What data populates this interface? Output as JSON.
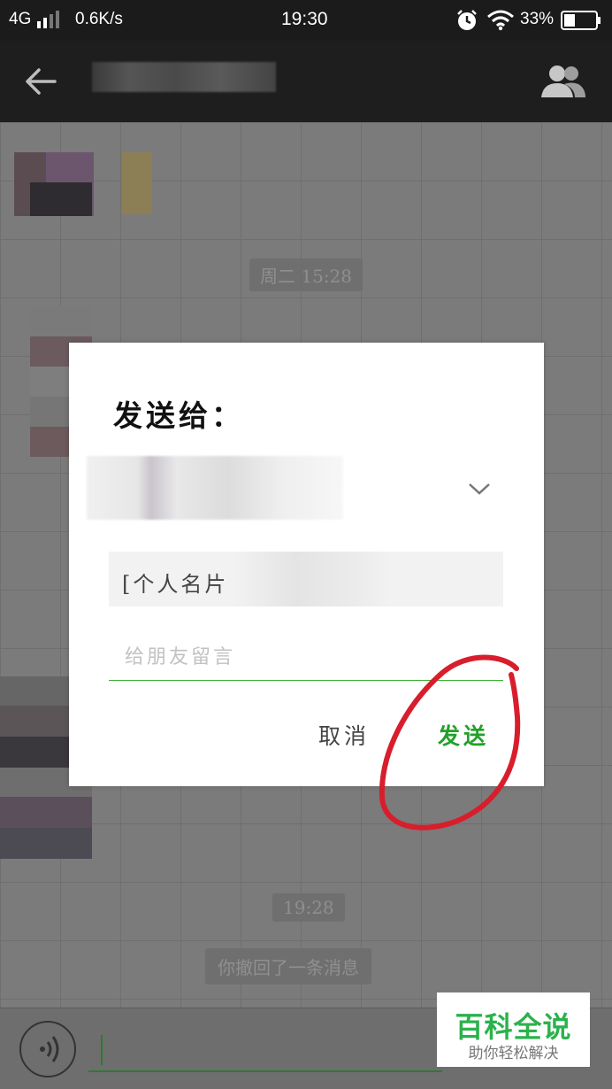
{
  "status_bar": {
    "network": "4G",
    "speed": "0.6K/s",
    "time": "19:30",
    "battery_percent": "33%",
    "icons": [
      "signal-icon",
      "alarm-icon",
      "wifi-icon",
      "battery-icon"
    ]
  },
  "title_bar": {
    "back_icon": "arrow-left-icon",
    "group_icon": "group-members-icon"
  },
  "chat": {
    "timestamps": [
      "周二 15:28",
      "19:28"
    ],
    "system_message": "你撤回了一条消息"
  },
  "dialog": {
    "title": "发送给：",
    "card_label": "[个人名片",
    "message_placeholder": "给朋友留言",
    "cancel_label": "取消",
    "send_label": "发送"
  },
  "watermark": {
    "title": "百科全说",
    "subtitle": "助你轻松解决"
  },
  "colors": {
    "accent_green": "#22a02a",
    "annotation_red": "#d81e2c",
    "status_bar_bg": "#1b1b1b"
  }
}
